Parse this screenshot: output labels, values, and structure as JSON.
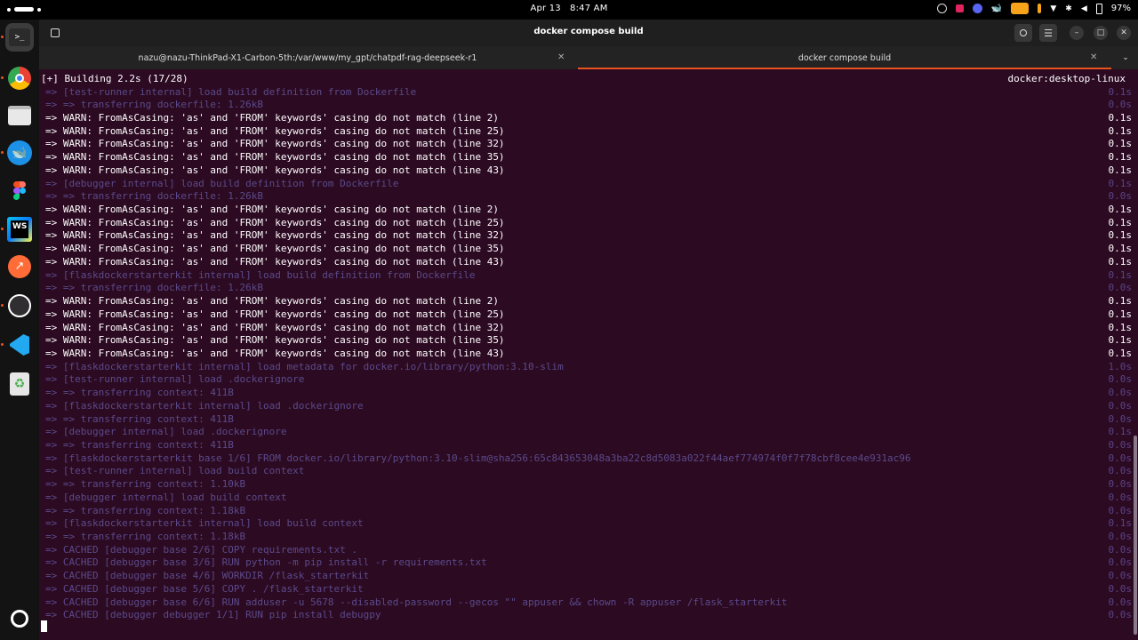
{
  "topbar": {
    "clock_date": "Apr 13",
    "clock_time": "8:47 AM",
    "battery": "97%",
    "tray_icons": [
      "ubuntu-pro-icon",
      "color-picker-icon",
      "discord-icon",
      "docker-whale-icon",
      "screen-record-icon",
      "microphone-icon",
      "wifi-icon",
      "bluetooth-icon",
      "volume-icon",
      "battery-icon"
    ]
  },
  "dock": {
    "apps": [
      {
        "name": "terminal",
        "icon": "terminal-icon",
        "active": true
      },
      {
        "name": "chrome",
        "icon": "chrome-icon"
      },
      {
        "name": "files",
        "icon": "files-icon"
      },
      {
        "name": "docker",
        "icon": "docker-icon"
      },
      {
        "name": "figma",
        "icon": "figma-icon"
      },
      {
        "name": "webstorm",
        "icon": "webstorm-icon",
        "label": "WS"
      },
      {
        "name": "postman",
        "icon": "postman-icon"
      },
      {
        "name": "obs",
        "icon": "obs-icon"
      },
      {
        "name": "vscode",
        "icon": "vscode-icon"
      },
      {
        "name": "trash",
        "icon": "trash-icon"
      }
    ],
    "bottom": {
      "name": "show-apps",
      "icon": "ubuntu-logo-icon"
    }
  },
  "window": {
    "title": "docker compose build",
    "tabs": [
      {
        "label": "nazu@nazu-ThinkPad-X1-Carbon-5th:/var/www/my_gpt/chatpdf-rag-deepseek-r1",
        "active": false
      },
      {
        "label": "docker compose build",
        "active": true
      }
    ]
  },
  "terminal": {
    "header_left": "[+] Building 2.2s (17/28)",
    "header_right": "docker:desktop-linux",
    "lines": [
      {
        "text": "=> [test-runner internal] load build definition from Dockerfile",
        "time": "0.1s",
        "dim": true
      },
      {
        "text": "=> => transferring dockerfile: 1.26kB",
        "time": "0.0s",
        "dim": true
      },
      {
        "text": "=> WARN: FromAsCasing: 'as' and 'FROM' keywords' casing do not match (line 2)",
        "time": "0.1s",
        "dim": false
      },
      {
        "text": "=> WARN: FromAsCasing: 'as' and 'FROM' keywords' casing do not match (line 25)",
        "time": "0.1s",
        "dim": false
      },
      {
        "text": "=> WARN: FromAsCasing: 'as' and 'FROM' keywords' casing do not match (line 32)",
        "time": "0.1s",
        "dim": false
      },
      {
        "text": "=> WARN: FromAsCasing: 'as' and 'FROM' keywords' casing do not match (line 35)",
        "time": "0.1s",
        "dim": false
      },
      {
        "text": "=> WARN: FromAsCasing: 'as' and 'FROM' keywords' casing do not match (line 43)",
        "time": "0.1s",
        "dim": false
      },
      {
        "text": "=> [debugger internal] load build definition from Dockerfile",
        "time": "0.1s",
        "dim": true
      },
      {
        "text": "=> => transferring dockerfile: 1.26kB",
        "time": "0.0s",
        "dim": true
      },
      {
        "text": "=> WARN: FromAsCasing: 'as' and 'FROM' keywords' casing do not match (line 2)",
        "time": "0.1s",
        "dim": false
      },
      {
        "text": "=> WARN: FromAsCasing: 'as' and 'FROM' keywords' casing do not match (line 25)",
        "time": "0.1s",
        "dim": false
      },
      {
        "text": "=> WARN: FromAsCasing: 'as' and 'FROM' keywords' casing do not match (line 32)",
        "time": "0.1s",
        "dim": false
      },
      {
        "text": "=> WARN: FromAsCasing: 'as' and 'FROM' keywords' casing do not match (line 35)",
        "time": "0.1s",
        "dim": false
      },
      {
        "text": "=> WARN: FromAsCasing: 'as' and 'FROM' keywords' casing do not match (line 43)",
        "time": "0.1s",
        "dim": false
      },
      {
        "text": "=> [flaskdockerstarterkit internal] load build definition from Dockerfile",
        "time": "0.1s",
        "dim": true
      },
      {
        "text": "=> => transferring dockerfile: 1.26kB",
        "time": "0.0s",
        "dim": true
      },
      {
        "text": "=> WARN: FromAsCasing: 'as' and 'FROM' keywords' casing do not match (line 2)",
        "time": "0.1s",
        "dim": false
      },
      {
        "text": "=> WARN: FromAsCasing: 'as' and 'FROM' keywords' casing do not match (line 25)",
        "time": "0.1s",
        "dim": false
      },
      {
        "text": "=> WARN: FromAsCasing: 'as' and 'FROM' keywords' casing do not match (line 32)",
        "time": "0.1s",
        "dim": false
      },
      {
        "text": "=> WARN: FromAsCasing: 'as' and 'FROM' keywords' casing do not match (line 35)",
        "time": "0.1s",
        "dim": false
      },
      {
        "text": "=> WARN: FromAsCasing: 'as' and 'FROM' keywords' casing do not match (line 43)",
        "time": "0.1s",
        "dim": false
      },
      {
        "text": "=> [flaskdockerstarterkit internal] load metadata for docker.io/library/python:3.10-slim",
        "time": "1.0s",
        "dim": true
      },
      {
        "text": "=> [test-runner internal] load .dockerignore",
        "time": "0.0s",
        "dim": true
      },
      {
        "text": "=> => transferring context: 411B",
        "time": "0.0s",
        "dim": true
      },
      {
        "text": "=> [flaskdockerstarterkit internal] load .dockerignore",
        "time": "0.0s",
        "dim": true
      },
      {
        "text": "=> => transferring context: 411B",
        "time": "0.0s",
        "dim": true
      },
      {
        "text": "=> [debugger internal] load .dockerignore",
        "time": "0.1s",
        "dim": true
      },
      {
        "text": "=> => transferring context: 411B",
        "time": "0.0s",
        "dim": true
      },
      {
        "text": "=> [flaskdockerstarterkit base 1/6] FROM docker.io/library/python:3.10-slim@sha256:65c843653048a3ba22c8d5083a022f44aef774974f0f7f78cbf8cee4e931ac96",
        "time": "0.0s",
        "dim": true
      },
      {
        "text": "=> [test-runner internal] load build context",
        "time": "0.0s",
        "dim": true
      },
      {
        "text": "=> => transferring context: 1.10kB",
        "time": "0.0s",
        "dim": true
      },
      {
        "text": "=> [debugger internal] load build context",
        "time": "0.0s",
        "dim": true
      },
      {
        "text": "=> => transferring context: 1.18kB",
        "time": "0.0s",
        "dim": true
      },
      {
        "text": "=> [flaskdockerstarterkit internal] load build context",
        "time": "0.1s",
        "dim": true
      },
      {
        "text": "=> => transferring context: 1.18kB",
        "time": "0.0s",
        "dim": true
      },
      {
        "text": "=> CACHED [debugger base 2/6] COPY requirements.txt .",
        "time": "0.0s",
        "dim": true
      },
      {
        "text": "=> CACHED [debugger base 3/6] RUN python -m pip install -r requirements.txt",
        "time": "0.0s",
        "dim": true
      },
      {
        "text": "=> CACHED [debugger base 4/6] WORKDIR /flask_starterkit",
        "time": "0.0s",
        "dim": true
      },
      {
        "text": "=> CACHED [debugger base 5/6] COPY . /flask_starterkit",
        "time": "0.0s",
        "dim": true
      },
      {
        "text": "=> CACHED [debugger base 6/6] RUN adduser -u 5678 --disabled-password --gecos \"\" appuser && chown -R appuser /flask_starterkit",
        "time": "0.0s",
        "dim": true
      },
      {
        "text": "=> CACHED [debugger debugger 1/1] RUN pip install debugpy",
        "time": "0.0s",
        "dim": true
      }
    ]
  }
}
